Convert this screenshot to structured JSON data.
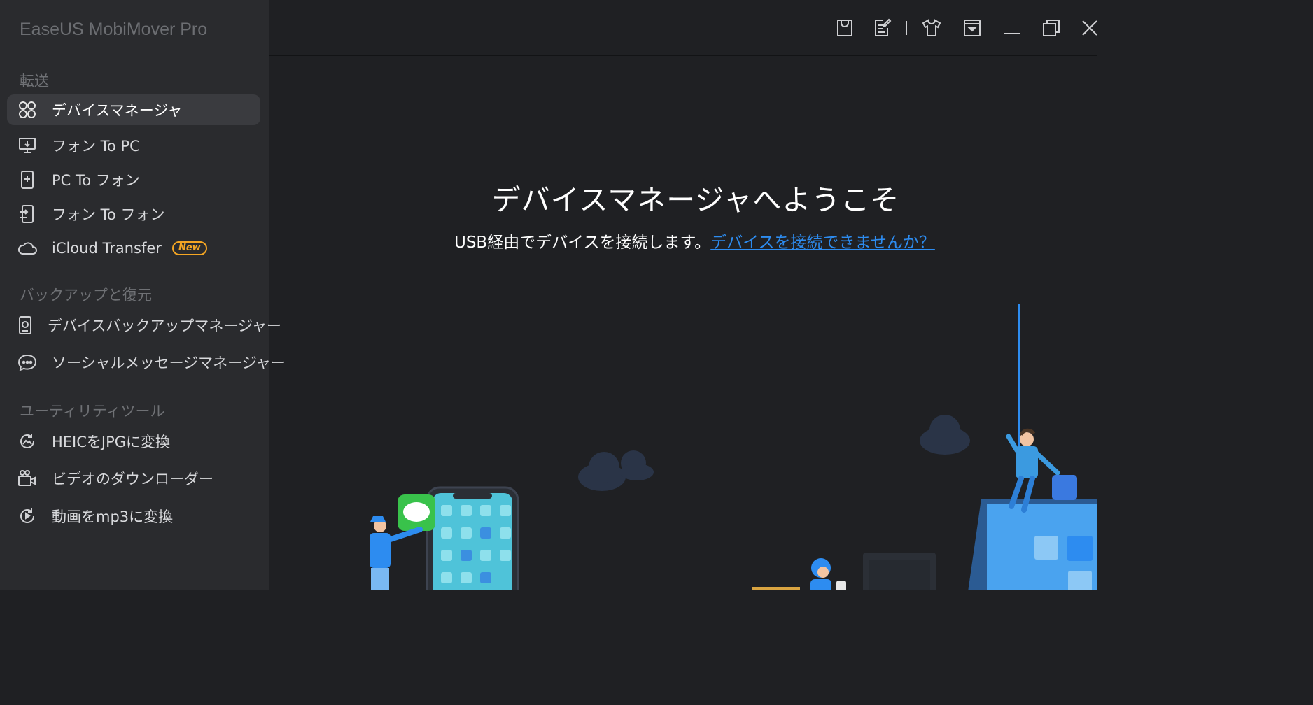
{
  "app": {
    "title": "EaseUS MobiMover Pro"
  },
  "sidebar": {
    "sections": [
      {
        "title": "転送"
      },
      {
        "title": "バックアップと復元"
      },
      {
        "title": "ユーティリティツール"
      }
    ],
    "items": [
      {
        "label": "デバイスマネージャ",
        "icon": "grid-icon",
        "active": true
      },
      {
        "label": "フォン To PC",
        "icon": "monitor-icon"
      },
      {
        "label": "PC To フォン",
        "icon": "phone-plus-icon"
      },
      {
        "label": "フォン To フォン",
        "icon": "phone-transfer-icon"
      },
      {
        "label": "iCloud Transfer",
        "icon": "cloud-icon",
        "badge": "New"
      },
      {
        "label": "デバイスバックアップマネージャー",
        "icon": "backup-icon"
      },
      {
        "label": "ソーシャルメッセージマネージャー",
        "icon": "chat-icon"
      },
      {
        "label": "HEICをJPGに変換",
        "icon": "image-convert-icon"
      },
      {
        "label": "ビデオのダウンローダー",
        "icon": "video-camera-icon"
      },
      {
        "label": "動画をmp3に変換",
        "icon": "music-convert-icon"
      }
    ]
  },
  "titlebar": {
    "buttons": [
      "shopping-bag-icon",
      "register-icon",
      "tshirt-icon",
      "dropdown-menu-icon",
      "minimize-icon",
      "restore-icon",
      "close-icon"
    ]
  },
  "main": {
    "welcome_title": "デバイスマネージャへようこそ",
    "welcome_text": "USB経由でデバイスを接続します。",
    "help_link": "デバイスを接続できませんか？"
  },
  "colors": {
    "accent": "#2d8cf0",
    "badge": "#f5a623",
    "sidebar_bg": "#2a2b2e",
    "main_bg": "#1f2023"
  }
}
